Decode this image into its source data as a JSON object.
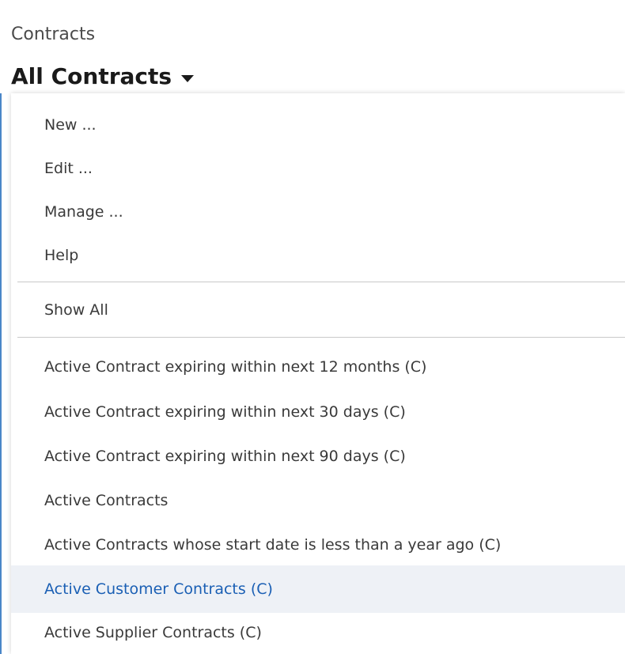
{
  "header": {
    "object_label": "Contracts",
    "view_title": "All Contracts",
    "caret_icon": "caret-down-icon"
  },
  "menu": {
    "actions": [
      {
        "label": "New ..."
      },
      {
        "label": "Edit ..."
      },
      {
        "label": "Manage ..."
      },
      {
        "label": "Help"
      }
    ],
    "show_all": {
      "label": "Show All"
    },
    "views": [
      {
        "label": "Active Contract expiring within next 12 months (C)"
      },
      {
        "label": "Active Contract expiring within next 30 days (C)"
      },
      {
        "label": "Active Contract expiring within next 90 days (C)"
      },
      {
        "label": "Active Contracts"
      },
      {
        "label": "Active Contracts whose start date is less than a year ago (C)"
      },
      {
        "label": "Active Customer Contracts (C)",
        "highlighted": true
      },
      {
        "label": "Active Supplier Contracts (C)"
      }
    ]
  },
  "colors": {
    "accent_border": "#4a86c8",
    "highlight_bg": "#eef1f6",
    "highlight_text": "#1a5fb4"
  }
}
